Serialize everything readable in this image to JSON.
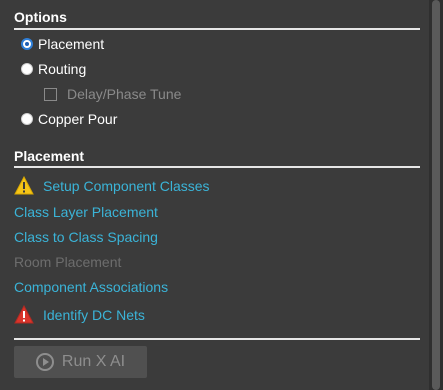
{
  "options": {
    "header": "Options",
    "radios": [
      {
        "label": "Placement",
        "selected": true
      },
      {
        "label": "Routing",
        "selected": false
      },
      {
        "label": "Copper Pour",
        "selected": false
      }
    ],
    "delay_checkbox": {
      "label": "Delay/Phase Tune",
      "checked": false,
      "enabled": false
    }
  },
  "placement": {
    "header": "Placement",
    "items": [
      {
        "label": "Setup Component Classes",
        "icon": "warning-icon",
        "icon_color": "#f5c518"
      },
      {
        "label": "Class Layer Placement"
      },
      {
        "label": "Class to Class Spacing"
      },
      {
        "label": "Room Placement",
        "enabled": false
      },
      {
        "label": "Component Associations"
      },
      {
        "label": "Identify DC Nets",
        "icon": "error-icon",
        "icon_color": "#d9342b"
      }
    ]
  },
  "run_button": {
    "label": "Run X AI",
    "enabled": false,
    "icon": "play-circle-icon"
  },
  "colors": {
    "background": "#3b3b3b",
    "link": "#3bb4d8",
    "disabled": "#6d6d6d",
    "accent": "#2f7fd8"
  }
}
